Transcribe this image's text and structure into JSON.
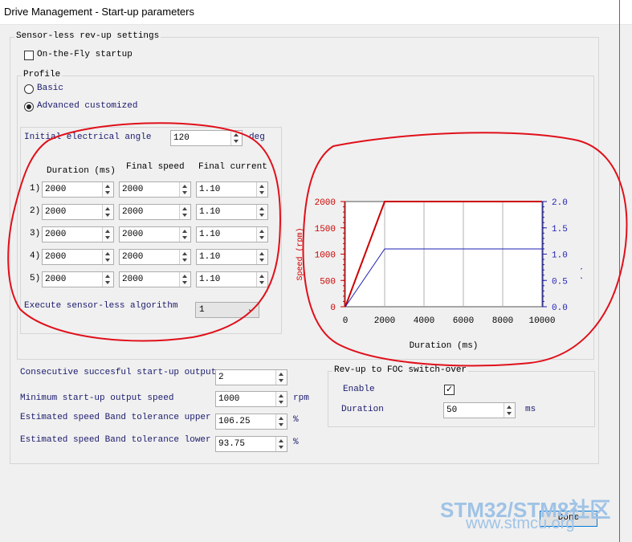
{
  "window": {
    "title": "Drive Management - Start-up parameters"
  },
  "sensorless": {
    "legend": "Sensor-less rev-up settings",
    "on_the_fly": {
      "label": "On-the-Fly startup",
      "checked": false
    },
    "profile": {
      "legend": "Profile",
      "basic": "Basic",
      "advanced": "Advanced customized",
      "selected": "advanced"
    },
    "initial_angle": {
      "label": "Initial electrical angle",
      "value": "120",
      "unit": "deg"
    },
    "headers": {
      "duration": "Duration (ms)",
      "speed": "Final speed",
      "current": "Final current"
    },
    "rows": [
      {
        "idx": "1)",
        "duration": "2000",
        "speed": "2000",
        "current": "1.10"
      },
      {
        "idx": "2)",
        "duration": "2000",
        "speed": "2000",
        "current": "1.10"
      },
      {
        "idx": "3)",
        "duration": "2000",
        "speed": "2000",
        "current": "1.10"
      },
      {
        "idx": "4)",
        "duration": "2000",
        "speed": "2000",
        "current": "1.10"
      },
      {
        "idx": "5)",
        "duration": "2000",
        "speed": "2000",
        "current": "1.10"
      }
    ],
    "execute": {
      "label": "Execute sensor-less algorithm",
      "value": "1"
    }
  },
  "bottom": {
    "consecutive": {
      "label": "Consecutive succesful start-up output",
      "value": "2"
    },
    "min_speed": {
      "label": "Minimum start-up output speed",
      "value": "1000",
      "unit": "rpm"
    },
    "tol_upper": {
      "label": "Estimated speed Band tolerance upper",
      "value": "106.25",
      "unit": "%"
    },
    "tol_lower": {
      "label": "Estimated speed Band tolerance lower",
      "value": "93.75",
      "unit": "%"
    }
  },
  "foc": {
    "legend": "Rev-up to FOC switch-over",
    "enable": {
      "label": "Enable",
      "checked": true
    },
    "duration": {
      "label": "Duration",
      "value": "50",
      "unit": "ms"
    }
  },
  "done_label": "Done",
  "watermark": {
    "line1": "STM32/STM8社区",
    "line2": "www.stmcu.org"
  },
  "colors": {
    "speed": "#cc0000",
    "current": "#1f1fb4",
    "annotation": "#e0101a"
  },
  "chart_data": {
    "type": "line",
    "xlabel": "Duration (ms)",
    "ylabel_left": "Speed (rpm)",
    "ylabel_right": "Current (A)",
    "xlim": [
      0,
      10000
    ],
    "ylim_left": [
      0,
      2000
    ],
    "ylim_right": [
      0,
      2.0
    ],
    "x_ticks": [
      "0",
      "2000",
      "4000",
      "6000",
      "8000",
      "10000"
    ],
    "y_ticks_left": [
      "0",
      "500",
      "1000",
      "1500",
      "2000"
    ],
    "y_ticks_right": [
      "0.0",
      "0.5",
      "1.0",
      "1.5",
      "2.0"
    ],
    "grid": true,
    "series": [
      {
        "axis": "left",
        "color": "#cc0000",
        "x": [
          0,
          2000,
          10000
        ],
        "y": [
          0,
          2000,
          2000
        ]
      },
      {
        "axis": "right",
        "color": "#1f1fb4",
        "x": [
          0,
          2000,
          10000
        ],
        "y": [
          0,
          1.1,
          1.1
        ]
      }
    ]
  }
}
